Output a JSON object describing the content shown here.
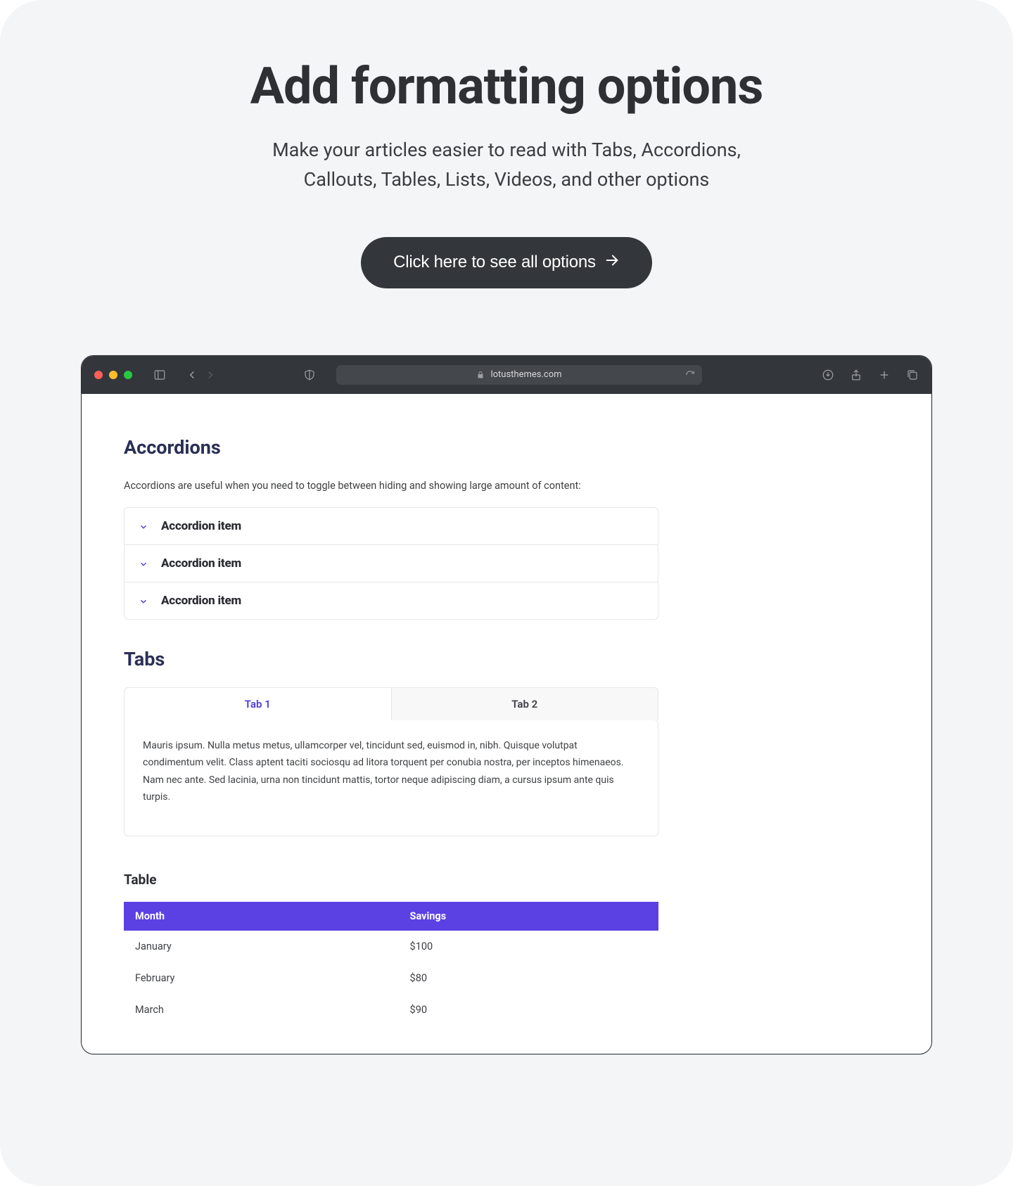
{
  "hero": {
    "title": "Add formatting options",
    "subtitle_line1": "Make your articles easier to read with Tabs, Accordions,",
    "subtitle_line2": "Callouts, Tables, Lists, Videos, and other options",
    "cta": "Click here to see all options"
  },
  "browser": {
    "url_host": "lotusthemes.com"
  },
  "accordions": {
    "title": "Accordions",
    "description": "Accordions are useful when you need to toggle between hiding and showing large amount of content:",
    "items": [
      {
        "label": "Accordion item"
      },
      {
        "label": "Accordion item"
      },
      {
        "label": "Accordion item"
      }
    ]
  },
  "tabs": {
    "title": "Tabs",
    "items": [
      {
        "label": "Tab 1",
        "active": true
      },
      {
        "label": "Tab 2",
        "active": false
      }
    ],
    "panel": "Mauris ipsum. Nulla metus metus, ullamcorper vel, tincidunt sed, euismod in, nibh. Quisque volutpat condimentum velit. Class aptent taciti sociosqu ad litora torquent per conubia nostra, per inceptos himenaeos. Nam nec ante. Sed lacinia, urna non tincidunt mattis, tortor neque adipiscing diam, a cursus ipsum ante quis turpis."
  },
  "table": {
    "title": "Table",
    "headers": [
      "Month",
      "Savings"
    ],
    "rows": [
      [
        "January",
        "$100"
      ],
      [
        "February",
        "$80"
      ],
      [
        "March",
        "$90"
      ]
    ]
  },
  "colors": {
    "accent_purple": "#5b40e4",
    "cta_bg": "#33363a",
    "chrome_bg": "#33363b",
    "heading_navy": "#2a2f56"
  }
}
